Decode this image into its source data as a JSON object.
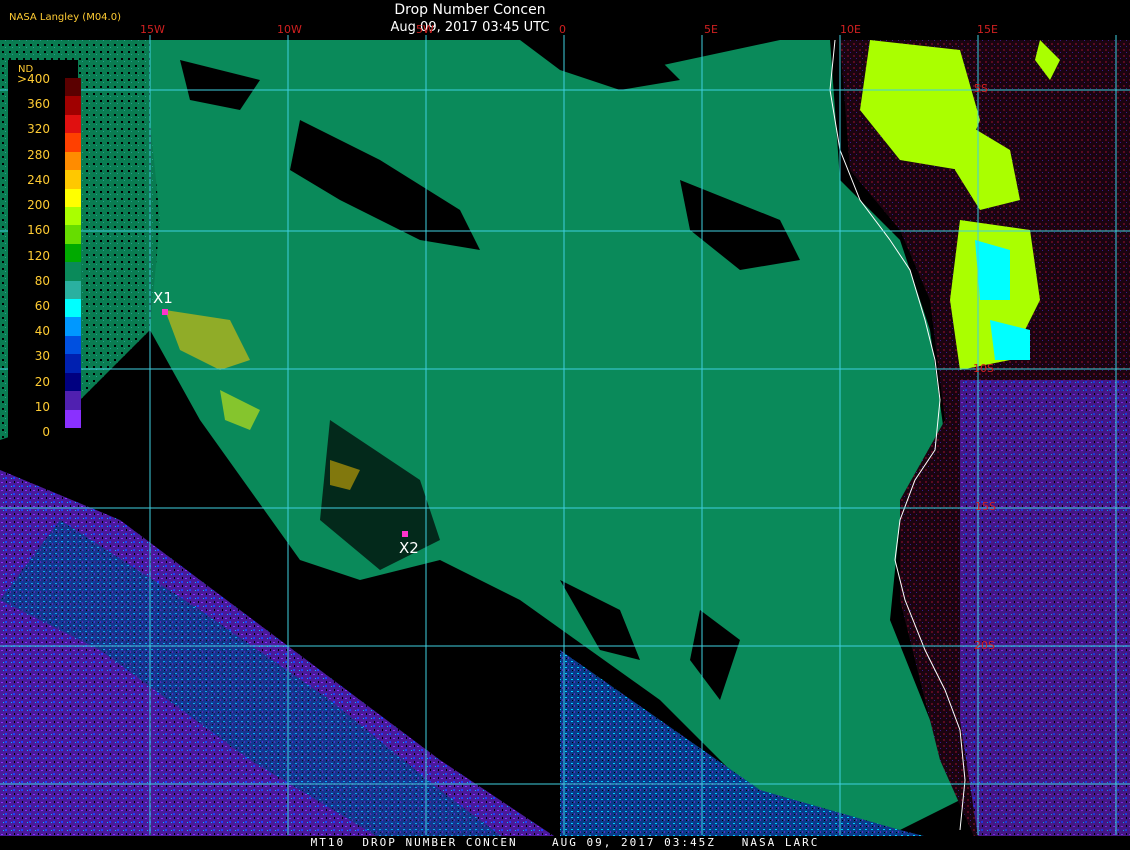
{
  "header": {
    "title": "Drop Number Concen",
    "timestamp": "Aug 09, 2017 03:45 UTC",
    "credit": "NASA Langley (M04.0)"
  },
  "grid": {
    "lon_labels": [
      "15W",
      "10W",
      "5W",
      "0",
      "5E",
      "10E",
      "15E"
    ],
    "lat_labels": [
      "5S",
      "10S",
      "15S",
      "20S"
    ]
  },
  "legend": {
    "title": "ND",
    "labels": [
      ">400",
      "360",
      "320",
      "280",
      "240",
      "200",
      "160",
      "120",
      "80",
      "60",
      "40",
      "30",
      "20",
      "10",
      "0"
    ],
    "colors": [
      "#5a0000",
      "#a00000",
      "#e01010",
      "#ff4000",
      "#ff8c00",
      "#ffc800",
      "#ffff00",
      "#aaff00",
      "#66dd00",
      "#00aa00",
      "#0a8a5a",
      "#2ab0a0",
      "#00ffff",
      "#0098ff",
      "#0050e0",
      "#0020b0",
      "#000080",
      "#5020b0",
      "#8a30ff"
    ]
  },
  "markers": [
    {
      "label": "X1"
    },
    {
      "label": "X2"
    }
  ],
  "footer": {
    "text": "MT10  DROP NUMBER CONCEN    AUG 09, 2017 03:45Z   NASA LARC"
  },
  "colors": {
    "stratocumulus": "#0a8a5a",
    "clear": "#000000",
    "grid": "#3fd0e0",
    "title_text": "#ffffff",
    "label_orange": "#ffcc33",
    "label_red": "#d02020",
    "marker": "#ff33cc"
  }
}
